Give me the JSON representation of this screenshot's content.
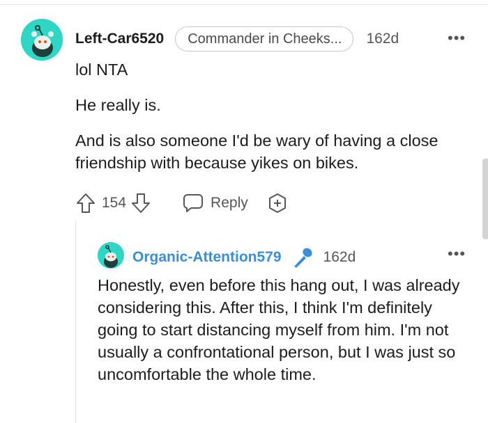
{
  "comment": {
    "username": "Left-Car6520",
    "flair": "Commander in Cheeks...",
    "age": "162d",
    "more": "•••",
    "paragraphs": [
      "lol NTA",
      "He really is.",
      "And is also someone I'd be wary of having a close friendship with because yikes on bikes."
    ],
    "upvote_icon": "upvote-arrow-icon",
    "vote_count": "154",
    "downvote_icon": "downvote-arrow-icon",
    "reply_label": "Reply",
    "award_icon": "add-award-icon"
  },
  "reply": {
    "username": "Organic-Attention579",
    "op_icon": "microphone-icon",
    "age": "162d",
    "more": "•••",
    "text": "Honestly, even before this hang out, I was already considering this. After this, I think I'm definitely going to start distancing myself from him. I'm not usually a confrontational person, but I was just so uncomfortable the whole time."
  },
  "colors": {
    "avatar_bg": "#2fd6c5",
    "reply_username": "#3a8ed8",
    "op_icon": "#3a8ed8"
  }
}
